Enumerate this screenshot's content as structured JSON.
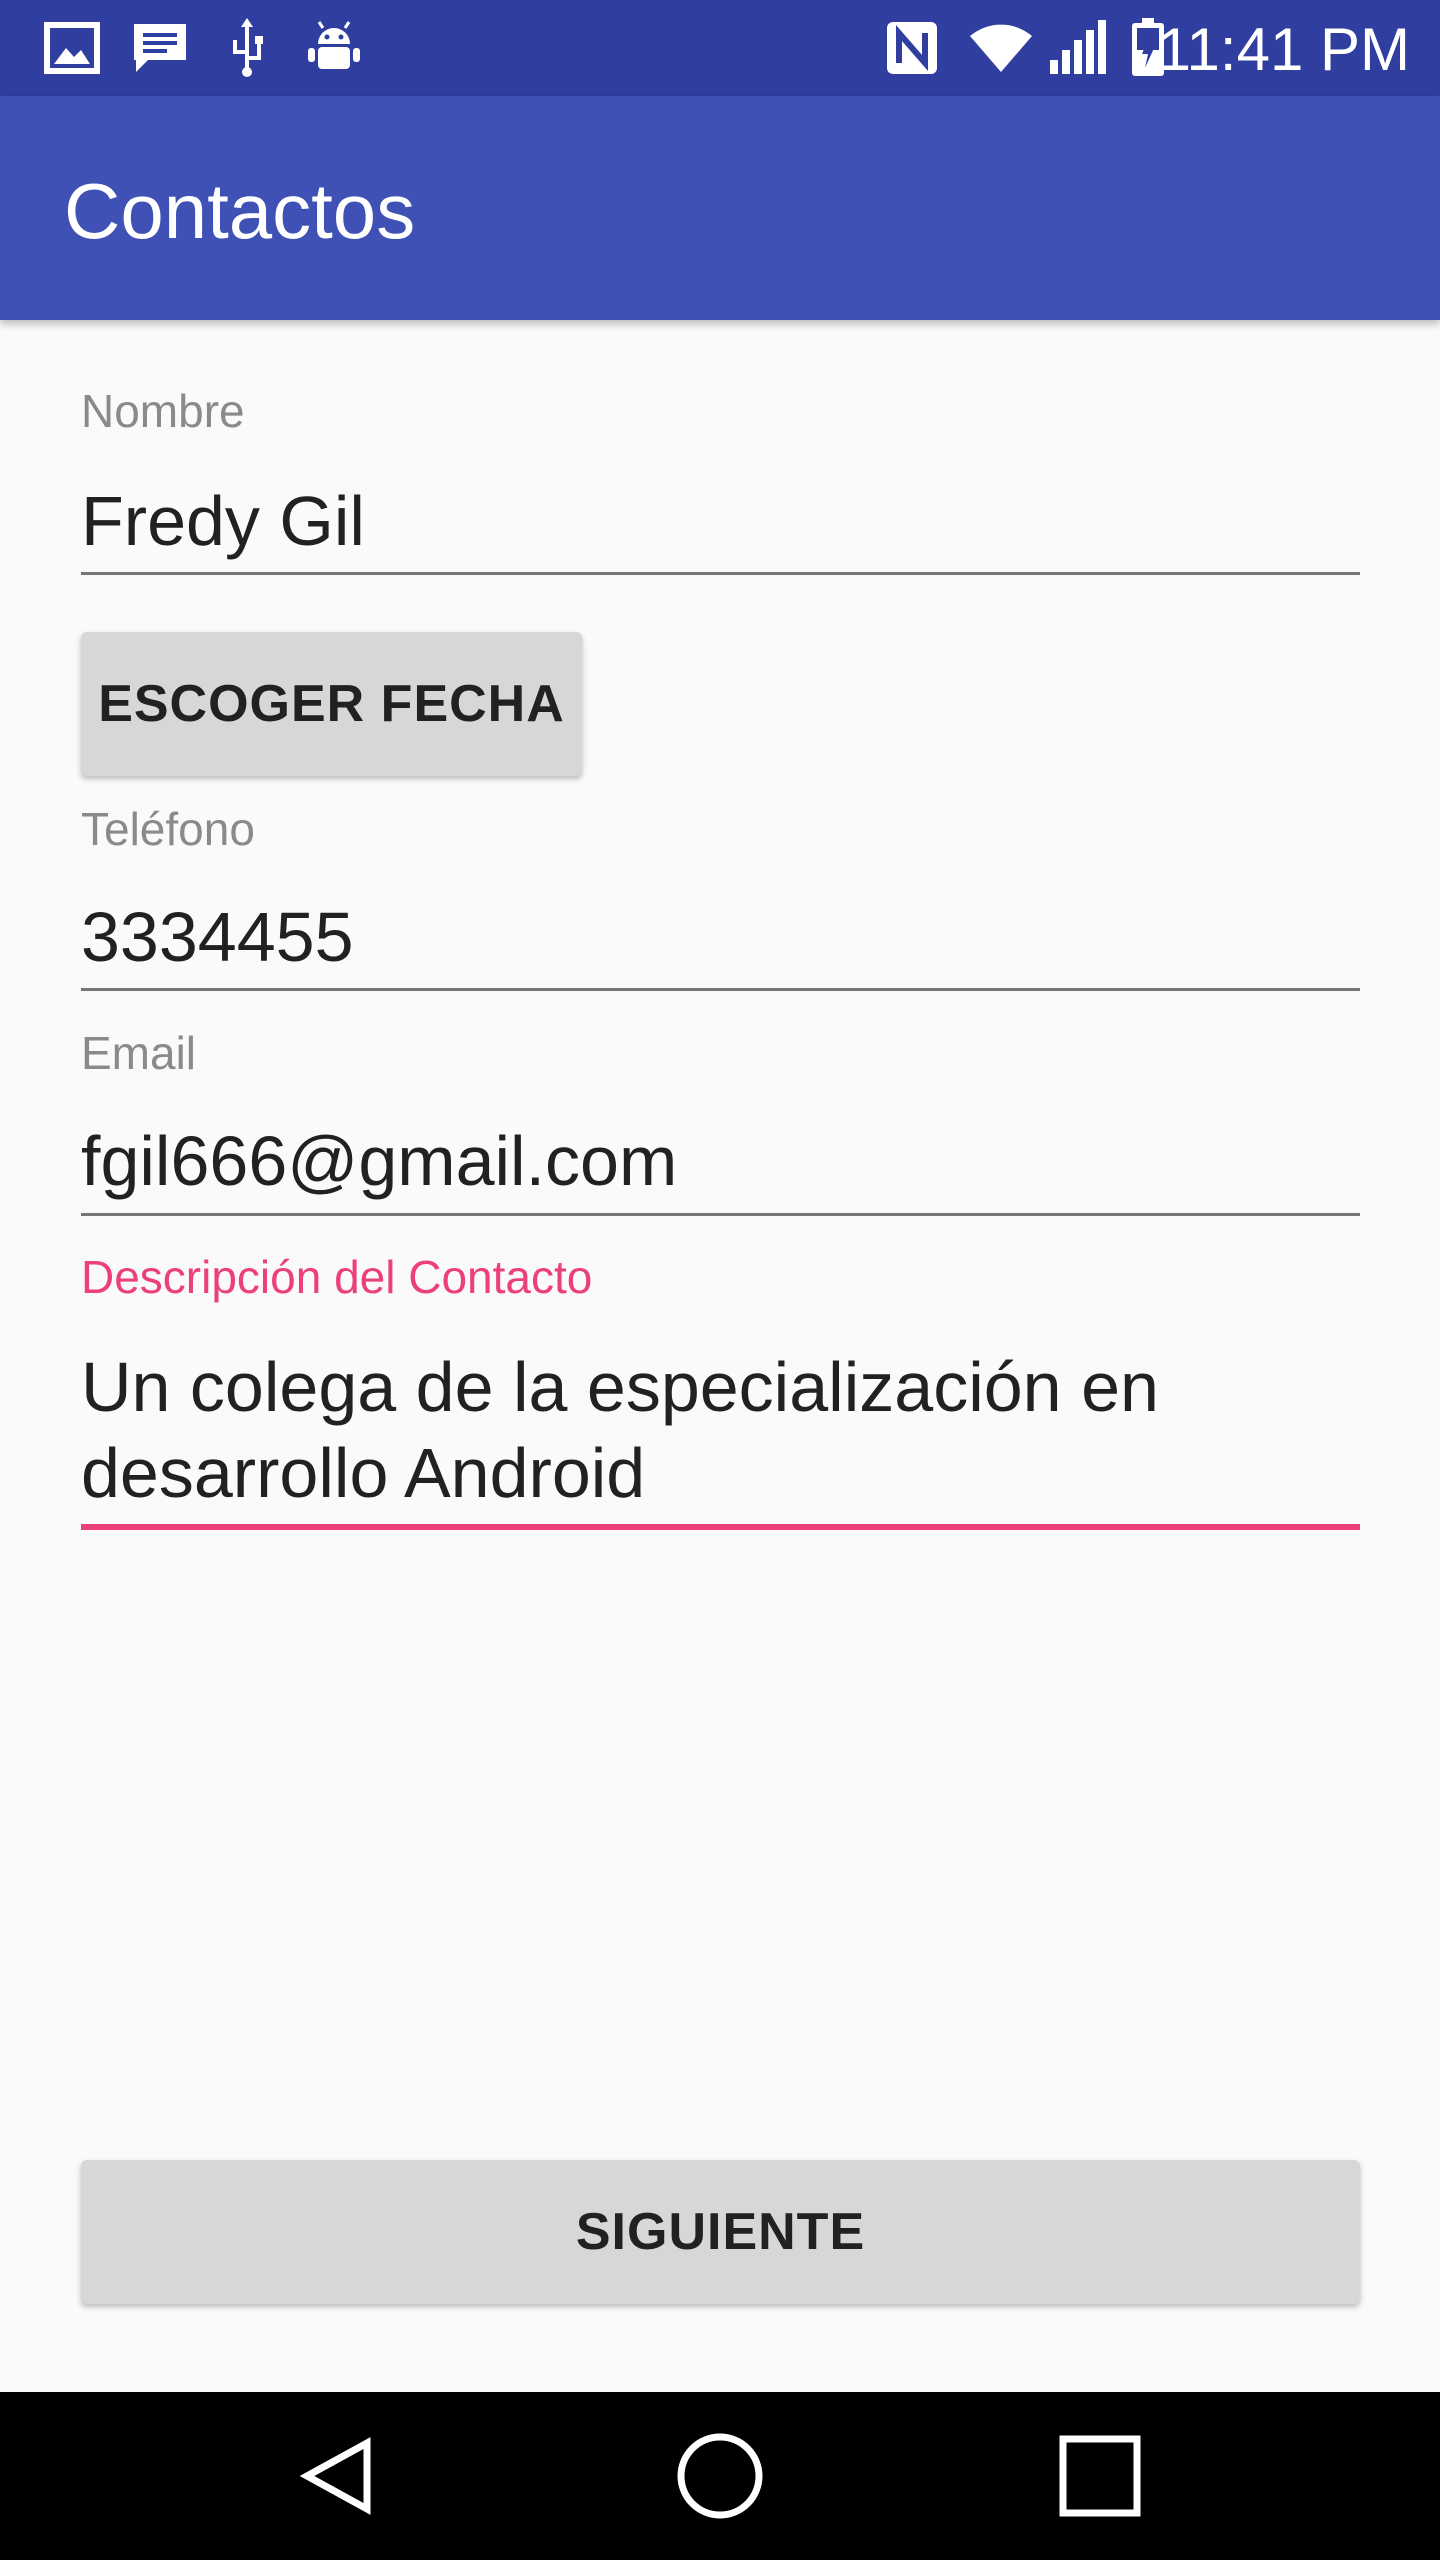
{
  "status_bar": {
    "time": "11:41 PM",
    "left_icons": [
      "image-icon",
      "message-icon",
      "usb-icon",
      "android-debug-icon"
    ],
    "right_icons": [
      "nfc-icon",
      "wifi-icon",
      "signal-icon",
      "battery-charging-icon"
    ]
  },
  "app_bar": {
    "title": "Contactos"
  },
  "form": {
    "nombre": {
      "label": "Nombre",
      "value": "Fredy Gil"
    },
    "fecha_button": "ESCOGER FECHA",
    "telefono": {
      "label": "Teléfono",
      "value": "3334455"
    },
    "email": {
      "label": "Email",
      "value": "fgil666@gmail.com"
    },
    "descripcion": {
      "label": "Descripción del Contacto",
      "value_line1": "Un colega de la especialización en",
      "value_line2": "desarrollo Android"
    },
    "next_button": "SIGUIENTE"
  },
  "nav_bar": {
    "icons": [
      "back-icon",
      "home-icon",
      "recents-icon"
    ]
  },
  "colors": {
    "status_bar": "#303f9f",
    "app_bar": "#3f51b5",
    "accent": "#ec407a",
    "background": "#fafafa",
    "button": "#d6d7d7"
  }
}
